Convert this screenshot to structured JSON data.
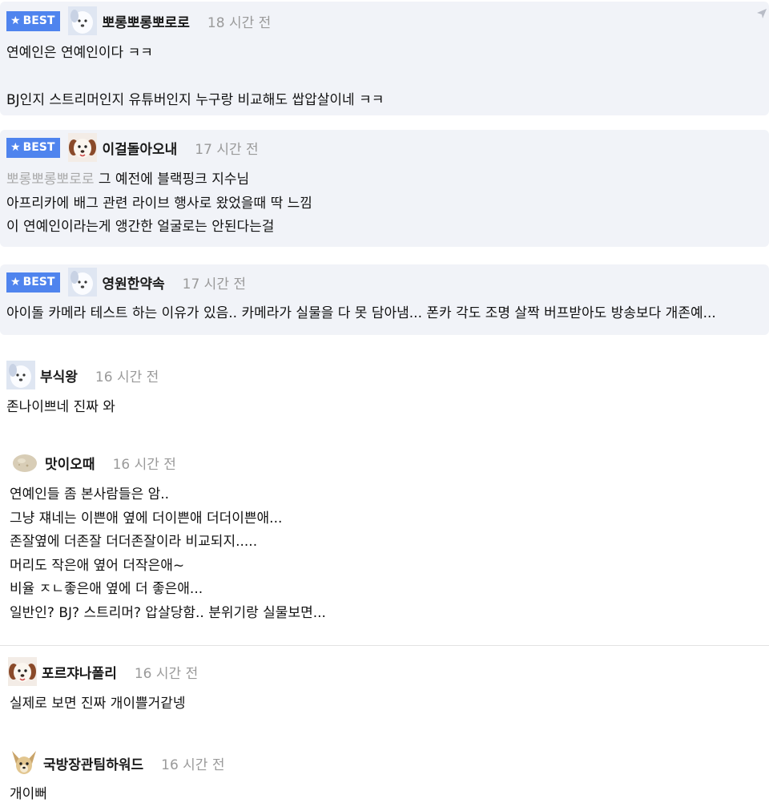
{
  "comments": [
    {
      "best": true,
      "badge_label": "BEST",
      "avatar": "white-dog-avatar",
      "nickname": "뽀롱뽀롱뽀로로",
      "time": "18 시간 전",
      "lines": [
        "연예인은 연예인이다 ㅋㅋ",
        "",
        "BJ인지 스트리머인지 유튜버인지 누구랑 비교해도 쌉압살이네 ㅋㅋ"
      ]
    },
    {
      "best": true,
      "badge_label": "BEST",
      "avatar": "brown-dog-avatar",
      "nickname": "이걸돌아오내",
      "time": "17 시간 전",
      "mention": "뽀롱뽀롱뽀로로",
      "lines": [
        "그 예전에 블랙핑크 지수님",
        "아프리카에 배그 관련 라이브 행사로 왔었을때 딱 느낌",
        "이 연예인이라는게 앵간한 얼굴로는 안된다는걸"
      ]
    },
    {
      "best": true,
      "badge_label": "BEST",
      "avatar": "white-dog-avatar",
      "nickname": "영원한약속",
      "time": "17 시간 전",
      "lines": [
        "아이돌 카메라 테스트 하는 이유가 있음.. 카메라가 실물을 다 못 담아냄... 폰카 각도 조명 살짝 버프받아도 방송보다 개존예..."
      ]
    },
    {
      "best": false,
      "avatar": "white-dog-avatar",
      "nickname": "부식왕",
      "time": "16 시간 전",
      "lines": [
        "존나이쁘네 진짜 와"
      ]
    },
    {
      "best": false,
      "avatar": "potato-avatar",
      "nickname": "맛이오때",
      "time": "16 시간 전",
      "lines": [
        "연예인들 좀 본사람들은 암..",
        "그냥 쟤네는 이쁜애 옆에 더이쁜애 더더이쁜애...",
        "존잘옆에 더존잘 더더존잘이라 비교되지.....",
        "머리도 작은애 옆어 더작은애~",
        "비율 ㅈㄴ좋은애 옆에 더 좋은애...",
        "일반인? BJ? 스트리머? 압살당함.. 분위기랑 실물보면..."
      ]
    },
    {
      "best": false,
      "avatar": "brown-dog-avatar",
      "nickname": "포르쟈나폴리",
      "time": "16 시간 전",
      "lines": [
        "실제로 보면 진짜 개이쁠거같넹"
      ]
    },
    {
      "best": false,
      "avatar": "chihuahua-avatar",
      "nickname": "국방장관팀하워드",
      "time": "16 시간 전",
      "lines": [
        "개이뻐"
      ]
    }
  ],
  "icons": {
    "badge_star": "star-icon",
    "send": "send-arrow-icon"
  },
  "colors": {
    "best_badge": "#4f84ee",
    "best_card_bg": "#f1f3f8",
    "time_text": "#9a9a9a",
    "mention_text": "#a9a9a9"
  }
}
